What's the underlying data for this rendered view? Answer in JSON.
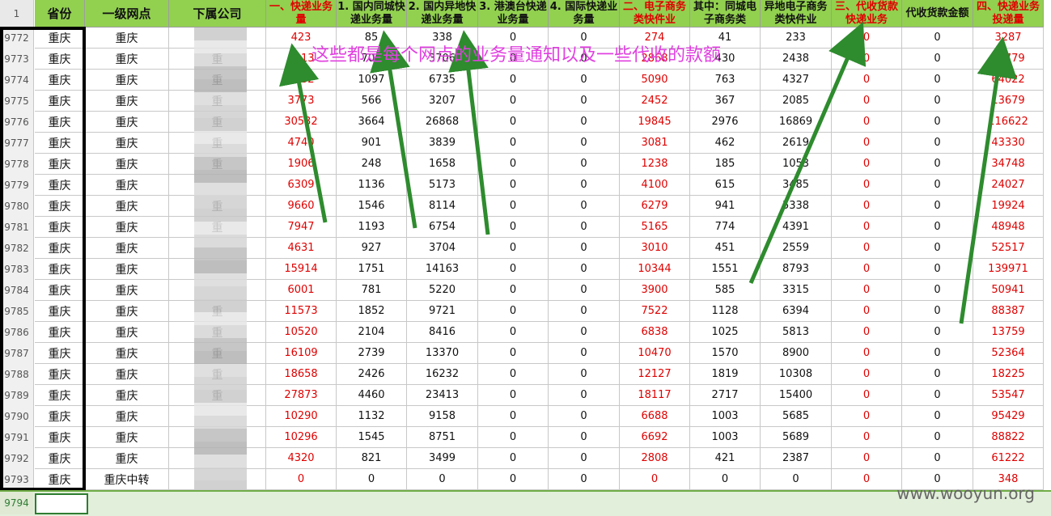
{
  "header_row_number": "1",
  "headers": [
    {
      "label": "省份",
      "red": false
    },
    {
      "label": "一级网点",
      "red": false
    },
    {
      "label": "下属公司",
      "red": false
    },
    {
      "label": "一、快递业务量",
      "red": true
    },
    {
      "label": "1. 国内同城快递业务量",
      "red": false
    },
    {
      "label": "2. 国内异地快递业务量",
      "red": false
    },
    {
      "label": "3. 港澳台快递业务量",
      "red": false
    },
    {
      "label": "4. 国际快递业务量",
      "red": false
    },
    {
      "label": "二、电子商务类快件业",
      "red": true
    },
    {
      "label": "其中：同城电子商务类",
      "red": false
    },
    {
      "label": "异地电子商务类快件业",
      "red": false
    },
    {
      "label": "三、代收货款快递业务",
      "red": true
    },
    {
      "label": "代收货款金额",
      "red": false
    },
    {
      "label": "四、快递业务投递量",
      "red": true
    }
  ],
  "rows": [
    {
      "n": "9772",
      "c": [
        "重庆",
        "重庆",
        "",
        "423",
        "85",
        "338",
        "0",
        "0",
        "274",
        "41",
        "233",
        "0",
        "0",
        "3287"
      ]
    },
    {
      "n": "9773",
      "c": [
        "重庆",
        "重庆",
        "重",
        "4413",
        "707",
        "3706",
        "0",
        "0",
        "2868",
        "430",
        "2438",
        "0",
        "0",
        "71779"
      ]
    },
    {
      "n": "9774",
      "c": [
        "重庆",
        "重庆",
        "重",
        "7832",
        "1097",
        "6735",
        "0",
        "0",
        "5090",
        "763",
        "4327",
        "0",
        "0",
        "64022"
      ]
    },
    {
      "n": "9775",
      "c": [
        "重庆",
        "重庆",
        "重",
        "3773",
        "566",
        "3207",
        "0",
        "0",
        "2452",
        "367",
        "2085",
        "0",
        "0",
        "13679"
      ]
    },
    {
      "n": "9776",
      "c": [
        "重庆",
        "重庆",
        "重",
        "30532",
        "3664",
        "26868",
        "0",
        "0",
        "19845",
        "2976",
        "16869",
        "0",
        "0",
        "116622"
      ]
    },
    {
      "n": "9777",
      "c": [
        "重庆",
        "重庆",
        "重",
        "4740",
        "901",
        "3839",
        "0",
        "0",
        "3081",
        "462",
        "2619",
        "0",
        "0",
        "43330"
      ]
    },
    {
      "n": "9778",
      "c": [
        "重庆",
        "重庆",
        "重",
        "1906",
        "248",
        "1658",
        "0",
        "0",
        "1238",
        "185",
        "1053",
        "0",
        "0",
        "34748"
      ]
    },
    {
      "n": "9779",
      "c": [
        "重庆",
        "重庆",
        "",
        "6309",
        "1136",
        "5173",
        "0",
        "0",
        "4100",
        "615",
        "3485",
        "0",
        "0",
        "24027"
      ]
    },
    {
      "n": "9780",
      "c": [
        "重庆",
        "重庆",
        "重",
        "9660",
        "1546",
        "8114",
        "0",
        "0",
        "6279",
        "941",
        "5338",
        "0",
        "0",
        "19924"
      ]
    },
    {
      "n": "9781",
      "c": [
        "重庆",
        "重庆",
        "重",
        "7947",
        "1193",
        "6754",
        "0",
        "0",
        "5165",
        "774",
        "4391",
        "0",
        "0",
        "48948"
      ]
    },
    {
      "n": "9782",
      "c": [
        "重庆",
        "重庆",
        "",
        "4631",
        "927",
        "3704",
        "0",
        "0",
        "3010",
        "451",
        "2559",
        "0",
        "0",
        "52517"
      ]
    },
    {
      "n": "9783",
      "c": [
        "重庆",
        "重庆",
        "",
        "15914",
        "1751",
        "14163",
        "0",
        "0",
        "10344",
        "1551",
        "8793",
        "0",
        "0",
        "139971"
      ]
    },
    {
      "n": "9784",
      "c": [
        "重庆",
        "重庆",
        "",
        "6001",
        "781",
        "5220",
        "0",
        "0",
        "3900",
        "585",
        "3315",
        "0",
        "0",
        "50941"
      ]
    },
    {
      "n": "9785",
      "c": [
        "重庆",
        "重庆",
        "重",
        "11573",
        "1852",
        "9721",
        "0",
        "0",
        "7522",
        "1128",
        "6394",
        "0",
        "0",
        "88387"
      ]
    },
    {
      "n": "9786",
      "c": [
        "重庆",
        "重庆",
        "重",
        "10520",
        "2104",
        "8416",
        "0",
        "0",
        "6838",
        "1025",
        "5813",
        "0",
        "0",
        "13759"
      ]
    },
    {
      "n": "9787",
      "c": [
        "重庆",
        "重庆",
        "重",
        "16109",
        "2739",
        "13370",
        "0",
        "0",
        "10470",
        "1570",
        "8900",
        "0",
        "0",
        "52364"
      ]
    },
    {
      "n": "9788",
      "c": [
        "重庆",
        "重庆",
        "重",
        "18658",
        "2426",
        "16232",
        "0",
        "0",
        "12127",
        "1819",
        "10308",
        "0",
        "0",
        "18225"
      ]
    },
    {
      "n": "9789",
      "c": [
        "重庆",
        "重庆",
        "重",
        "27873",
        "4460",
        "23413",
        "0",
        "0",
        "18117",
        "2717",
        "15400",
        "0",
        "0",
        "53547"
      ]
    },
    {
      "n": "9790",
      "c": [
        "重庆",
        "重庆",
        "",
        "10290",
        "1132",
        "9158",
        "0",
        "0",
        "6688",
        "1003",
        "5685",
        "0",
        "0",
        "95429"
      ]
    },
    {
      "n": "9791",
      "c": [
        "重庆",
        "重庆",
        "",
        "10296",
        "1545",
        "8751",
        "0",
        "0",
        "6692",
        "1003",
        "5689",
        "0",
        "0",
        "88822"
      ]
    },
    {
      "n": "9792",
      "c": [
        "重庆",
        "重庆",
        "",
        "4320",
        "821",
        "3499",
        "0",
        "0",
        "2808",
        "421",
        "2387",
        "0",
        "0",
        "61222"
      ]
    },
    {
      "n": "9793",
      "c": [
        "重庆",
        "重庆中转",
        "",
        "0",
        "0",
        "0",
        "0",
        "0",
        "0",
        "0",
        "0",
        "0",
        "0",
        "348"
      ]
    }
  ],
  "last_row_number": "9794",
  "annotation_text": "这些都是每个网点的业务量通知以及一些代收的款额",
  "watermark": "www.wooyun.org",
  "colors": {
    "header_bg": "#92d050",
    "red_text": "#e00000",
    "annotation": "#e040e0",
    "arrow": "#2e8b2e"
  }
}
